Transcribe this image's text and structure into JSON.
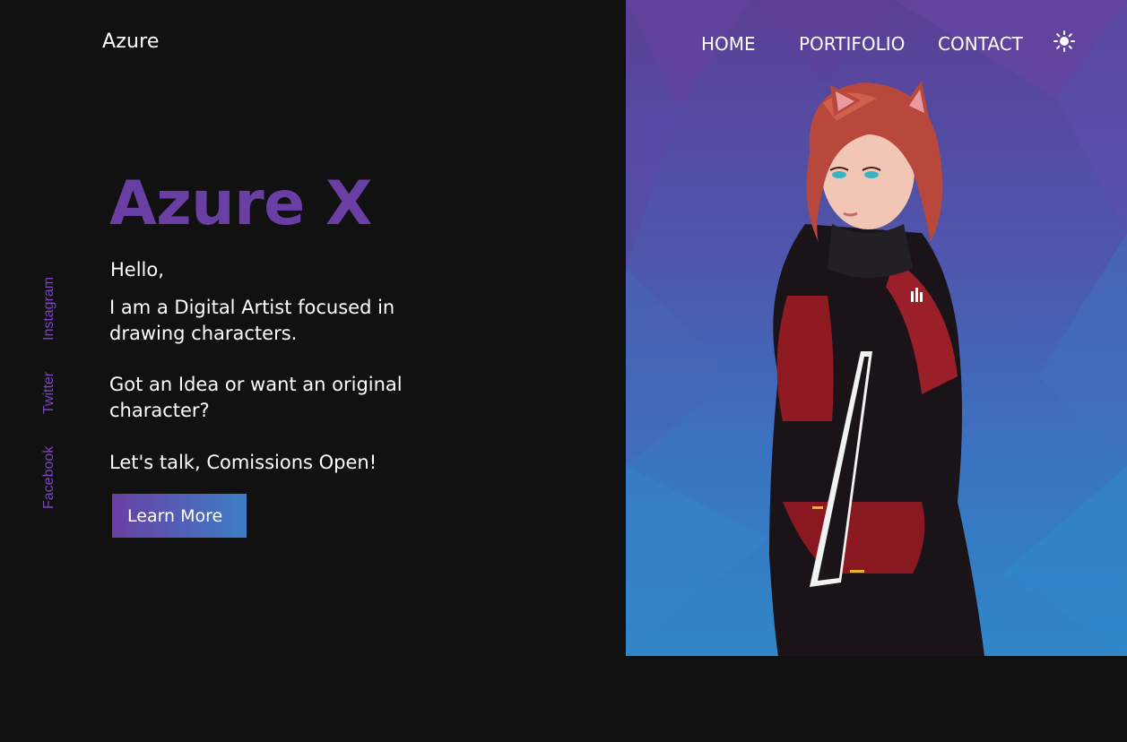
{
  "brand": {
    "logo_text": "Azure"
  },
  "nav": {
    "home": "HOME",
    "portfolio": "PORTIFOLIO",
    "contact": "CONTACT",
    "theme_icon": "sun-icon"
  },
  "social": {
    "instagram": "Instagram",
    "twitter": "Twitter",
    "facebook": "Facebook"
  },
  "hero": {
    "title": "Azure X",
    "greeting": "Hello,",
    "intro": "I am a Digital Artist focused in drawing characters.",
    "question": "Got an Idea or want an original character?",
    "cta_text": "Let's talk, Comissions Open!",
    "button_label": "Learn More"
  },
  "colors": {
    "accent_purple": "#6a3fa4",
    "accent_blue": "#3d7ec7",
    "background": "#111111",
    "social_link": "#7b45c4"
  }
}
